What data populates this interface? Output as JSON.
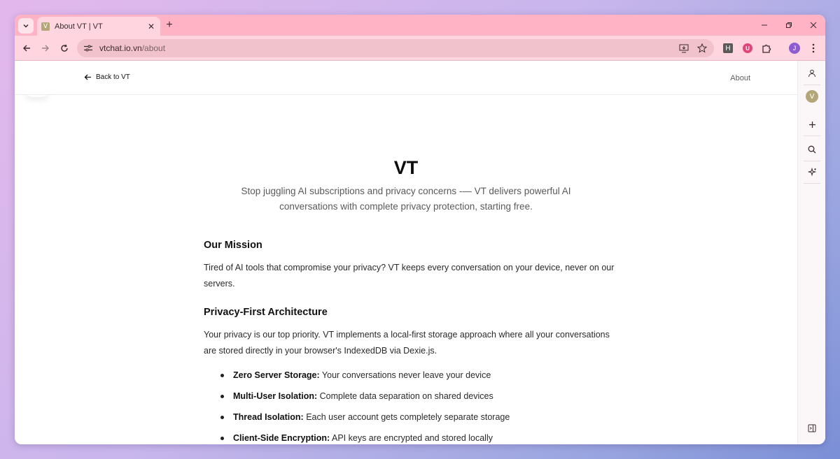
{
  "browser": {
    "tab": {
      "title": "About VT | VT",
      "favicon_letter": "V"
    },
    "address": {
      "domain": "vtchat.io.vn",
      "path": "/about"
    },
    "extensions": {
      "h_label": "H",
      "u_label": "U",
      "profile_initial": "J"
    }
  },
  "header": {
    "back_label": "Back to VT",
    "about_label": "About"
  },
  "hero": {
    "title": "VT",
    "subtitle": "Stop juggling AI subscriptions and privacy concerns -— VT delivers powerful AI conversations with complete privacy protection, starting free."
  },
  "mission": {
    "heading": "Our Mission",
    "text": "Tired of AI tools that compromise your privacy? VT keeps every conversation on your device, never on our servers."
  },
  "privacy": {
    "heading": "Privacy-First Architecture",
    "text": "Your privacy is our top priority. VT implements a local-first storage approach where all your conversations are stored directly in your browser's IndexedDB via Dexie.js.",
    "items": [
      {
        "label": "Zero Server Storage:",
        "text": "Your conversations never leave your device"
      },
      {
        "label": "Multi-User Isolation:",
        "text": "Complete data separation on shared devices"
      },
      {
        "label": "Thread Isolation:",
        "text": "Each user account gets completely separate storage"
      },
      {
        "label": "Client-Side Encryption:",
        "text": "API keys are encrypted and stored locally"
      }
    ]
  },
  "sidepanel": {
    "avatar_letter": "V"
  }
}
